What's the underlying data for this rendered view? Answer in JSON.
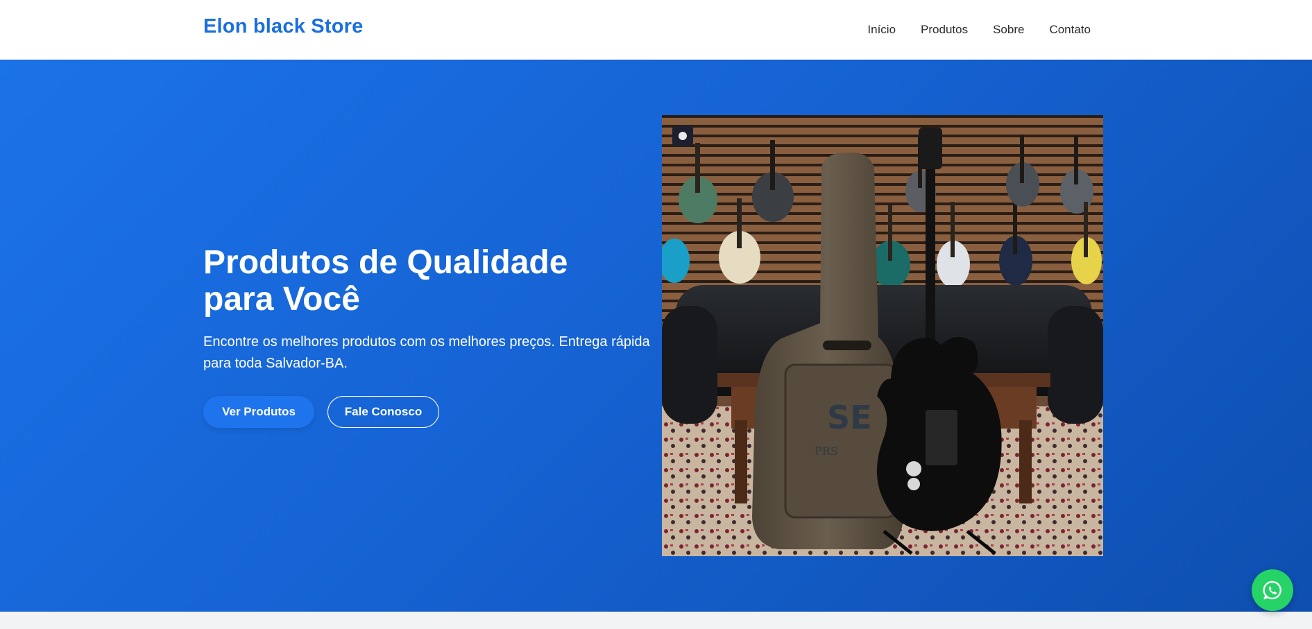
{
  "header": {
    "brand": "Elon black Store",
    "nav": [
      {
        "label": "Início"
      },
      {
        "label": "Produtos"
      },
      {
        "label": "Sobre"
      },
      {
        "label": "Contato"
      }
    ]
  },
  "hero": {
    "title": "Produtos de Qualidade para Você",
    "subtitle": "Encontre os melhores produtos com os melhores preços. Entrega rápida para toda Salvador-BA.",
    "primary_button": "Ver Produtos",
    "secondary_button": "Fale Conosco",
    "photo": {
      "subject": "guitar-case-and-electric-guitar-in-music-store",
      "case_logo": "SE",
      "case_sublogo": "PRS"
    }
  },
  "floating": {
    "whatsapp_icon": "whatsapp-icon"
  },
  "colors": {
    "brand": "#1a6fe0",
    "hero_gradient_start": "#1b73e8",
    "hero_gradient_end": "#0e4fb0",
    "primary_button": "#1e74ec",
    "whatsapp": "#25d366"
  }
}
